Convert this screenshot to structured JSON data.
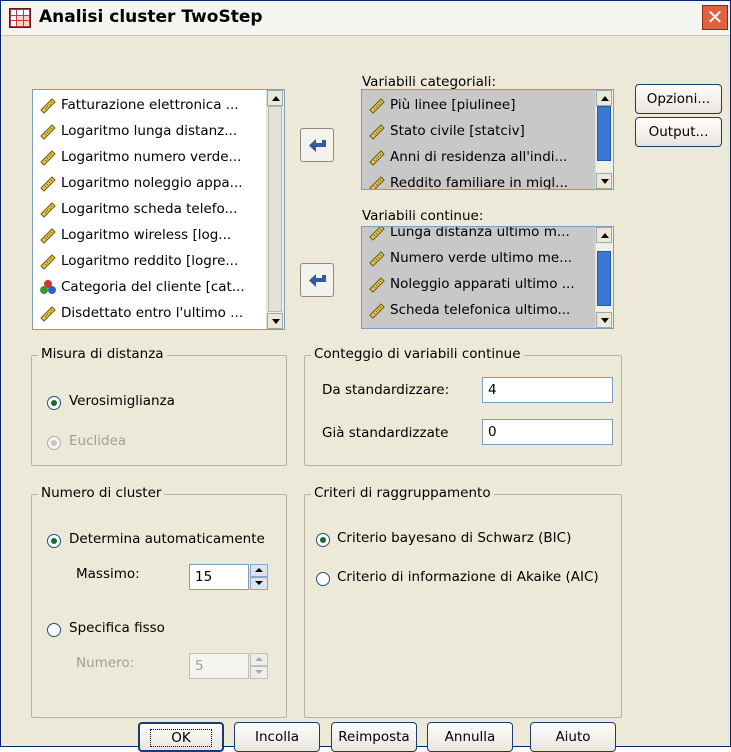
{
  "window": {
    "title": "Analisi cluster TwoStep"
  },
  "source_list": {
    "items": [
      {
        "label": "Fatturazione elettronica ...",
        "icon": "ruler-icon"
      },
      {
        "label": "Logaritmo lunga distanz...",
        "icon": "ruler-icon"
      },
      {
        "label": "Logaritmo numero verde...",
        "icon": "ruler-icon"
      },
      {
        "label": "Logaritmo noleggio appa...",
        "icon": "ruler-icon"
      },
      {
        "label": "Logaritmo scheda telefo...",
        "icon": "ruler-icon"
      },
      {
        "label": "Logaritmo wireless [log...",
        "icon": "ruler-icon"
      },
      {
        "label": "Logaritmo reddito [logre...",
        "icon": "ruler-icon"
      },
      {
        "label": "Categoria del cliente [cat...",
        "icon": "nominal-icon"
      },
      {
        "label": "Disdettato entro l'ultimo ...",
        "icon": "ruler-icon"
      }
    ]
  },
  "categorical": {
    "label": "Variabili categoriali:",
    "items": [
      {
        "label": "Più linee [piulinee]"
      },
      {
        "label": "Stato civile [statciv]"
      },
      {
        "label": "Anni di residenza all'indi..."
      },
      {
        "label": "Reddito familiare in migl..."
      }
    ]
  },
  "continuous": {
    "label": "Variabili continue:",
    "items": [
      {
        "label": "Lunga distanza ultimo m..."
      },
      {
        "label": "Numero verde ultimo me..."
      },
      {
        "label": "Noleggio apparati ultimo ..."
      },
      {
        "label": "Scheda telefonica ultimo..."
      }
    ]
  },
  "side_buttons": {
    "options": "Opzioni...",
    "output": "Output..."
  },
  "distance": {
    "title": "Misura di distanza",
    "likelihood": "Verosimiglianza",
    "euclidean": "Euclidea"
  },
  "continuous_count": {
    "title": "Conteggio di variabili continue",
    "to_standardize_label": "Da standardizzare:",
    "to_standardize_value": "4",
    "standardized_label": "Già standardizzate",
    "standardized_value": "0"
  },
  "clusters": {
    "title": "Numero di cluster",
    "auto_label": "Determina automaticamente",
    "max_label": "Massimo:",
    "max_value": "15",
    "fixed_label": "Specifica fisso",
    "number_label": "Numero:",
    "number_value": "5"
  },
  "criteria": {
    "title": "Criteri di raggruppamento",
    "bic": "Criterio bayesano di Schwarz (BIC)",
    "aic": "Criterio di informazione di Akaike (AIC)"
  },
  "buttons": {
    "ok": "OK",
    "paste": "Incolla",
    "reset": "Reimposta",
    "cancel": "Annulla",
    "help": "Aiuto"
  },
  "colors": {
    "title_bar": "#f4f4f0",
    "dialog_bg": "#ece9d8",
    "selected_list": "#c8c8c8",
    "close": "#e06040"
  }
}
